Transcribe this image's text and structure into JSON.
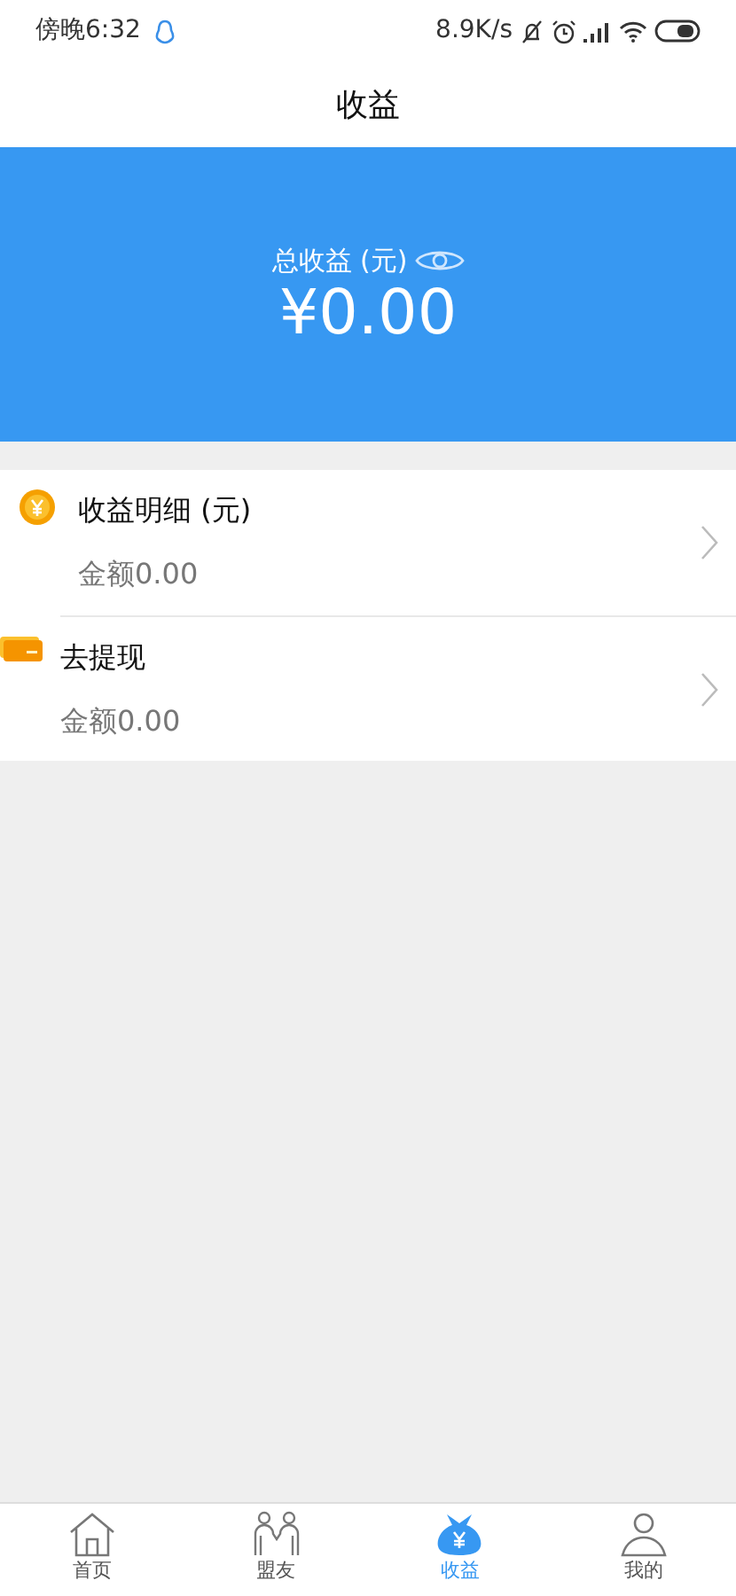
{
  "status_bar": {
    "time": "傍晚6:32",
    "speed": "8.9K/s"
  },
  "header": {
    "title": "收益"
  },
  "summary": {
    "label": "总收益 (元)",
    "amount": "¥0.00"
  },
  "items": [
    {
      "kind": "coin",
      "title": "收益明细 (元)",
      "amount": "金额0.00"
    },
    {
      "kind": "card",
      "title": "去提现",
      "amount": "金额0.00"
    }
  ],
  "tabs": [
    {
      "kind": "home",
      "label": "首页",
      "selected": false
    },
    {
      "kind": "friends",
      "label": "盟友",
      "selected": false
    },
    {
      "kind": "bag",
      "label": "收益",
      "selected": true
    },
    {
      "kind": "user",
      "label": "我的",
      "selected": false
    }
  ]
}
